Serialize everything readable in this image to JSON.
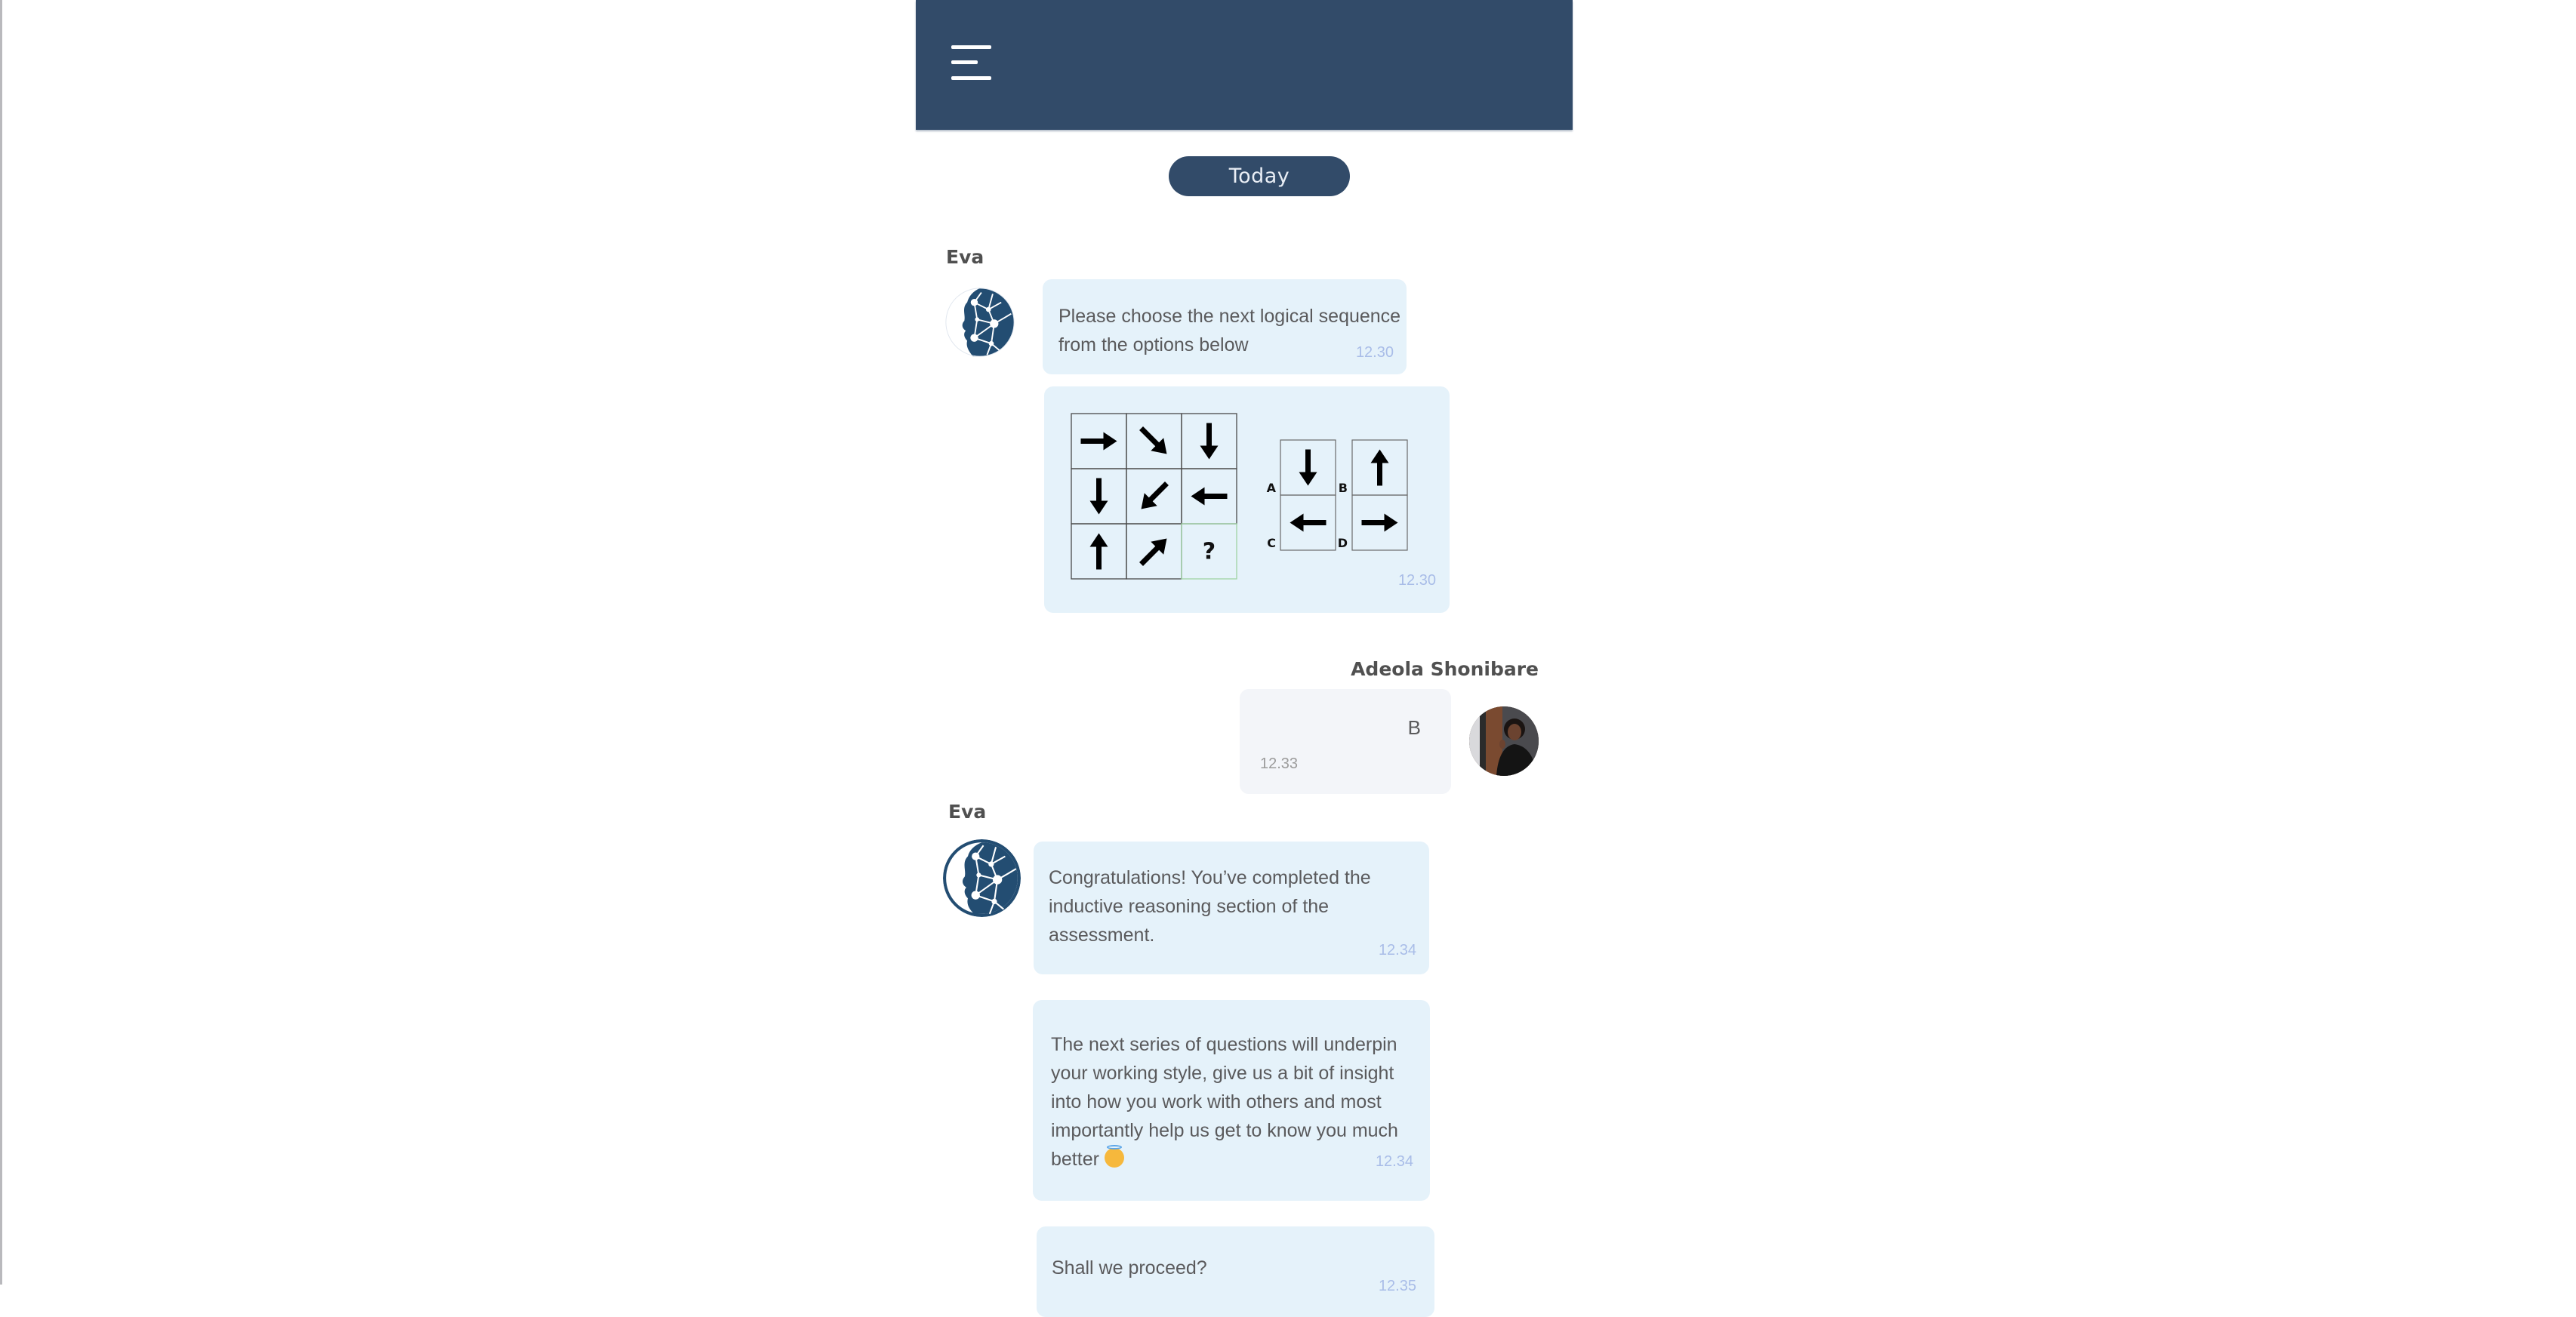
{
  "header": {
    "menu_icon": "hamburger-menu-icon"
  },
  "date_separator": "Today",
  "messages": [
    {
      "sender": "Eva",
      "avatar": "eva-brain-network-logo",
      "text": "Please choose the next logical sequence from the options below",
      "lines": [
        "Please choose the next logical sequence",
        "from the options below"
      ],
      "time": "12.30"
    },
    {
      "sender": "Eva",
      "type": "image",
      "description": "3x3 arrow sequence puzzle with answer options A-D",
      "puzzle": {
        "grid": [
          [
            "right",
            "down-right",
            "down"
          ],
          [
            "down",
            "down-left",
            "left"
          ],
          [
            "up",
            "up-right",
            "?"
          ]
        ],
        "missing_symbol": "?",
        "options": [
          {
            "label": "A",
            "arrow": "down"
          },
          {
            "label": "B",
            "arrow": "up"
          },
          {
            "label": "C",
            "arrow": "left"
          },
          {
            "label": "D",
            "arrow": "right"
          }
        ]
      },
      "time": "12.30"
    },
    {
      "sender": "Adeola Shonibare",
      "avatar": "user-photo",
      "text": "B",
      "time": "12.33"
    },
    {
      "sender": "Eva",
      "avatar": "eva-brain-network-logo",
      "text": "Congratulations! You’ve completed the inductive reasoning section of the assessment.",
      "lines": [
        "Congratulations! You’ve completed the",
        "inductive reasoning section of the",
        "assessment."
      ],
      "time": "12.34"
    },
    {
      "sender": "Eva",
      "text": "The next series of questions will underpin your working style, give us a bit of insight into how you work with others and most importantly help us get to know you much better 😇",
      "lines": [
        "The next series of questions will underpin",
        "your working style, give us a bit of insight",
        "into how you work with others and most",
        "importantly help us get to know you much",
        "better"
      ],
      "emoji": "smiling-face-with-halo",
      "time": "12.34"
    },
    {
      "sender": "Eva",
      "text": "Shall we proceed?",
      "time": "12.35"
    }
  ],
  "colors": {
    "header_bg": "#324b69",
    "bot_bubble": "#e5f2fa",
    "user_bubble": "#f3f5f9",
    "timestamp": "#a9bde8"
  }
}
